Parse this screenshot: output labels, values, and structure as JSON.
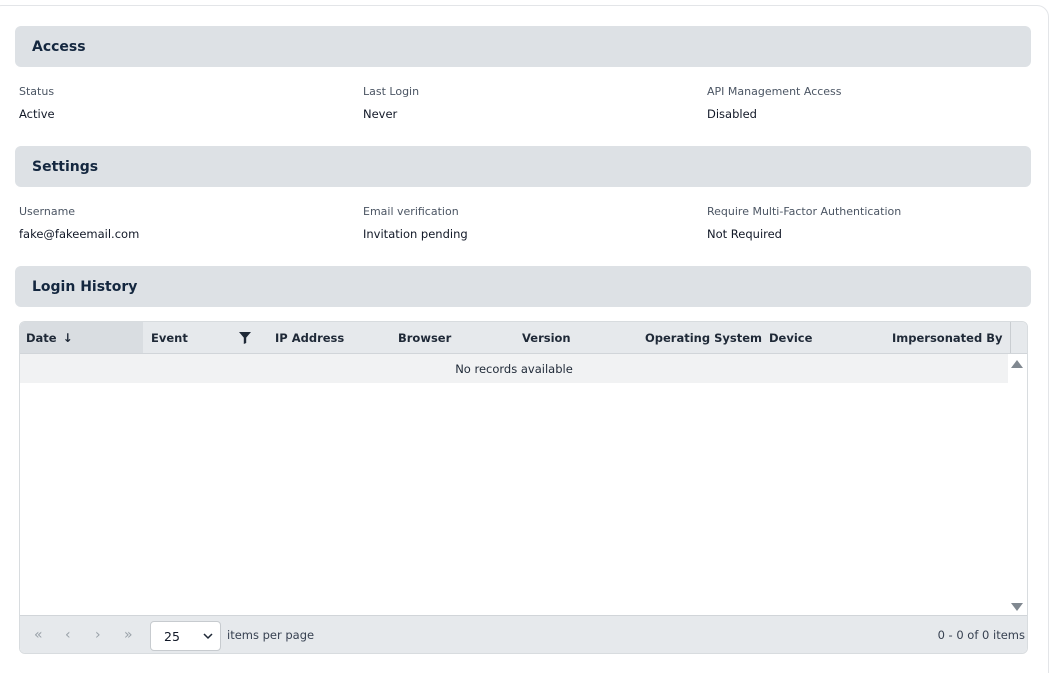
{
  "access": {
    "title": "Access",
    "fields": [
      {
        "label": "Status",
        "value": "Active"
      },
      {
        "label": "Last Login",
        "value": "Never"
      },
      {
        "label": "API Management Access",
        "value": "Disabled"
      }
    ]
  },
  "settings": {
    "title": "Settings",
    "fields": [
      {
        "label": "Username",
        "value": "fake@fakeemail.com"
      },
      {
        "label": "Email verification",
        "value": "Invitation pending"
      },
      {
        "label": "Require Multi-Factor Authentication",
        "value": "Not Required"
      }
    ]
  },
  "login_history": {
    "title": "Login History",
    "columns": [
      "Date",
      "Event",
      "IP Address",
      "Browser",
      "Version",
      "Operating System",
      "Device",
      "Impersonated By"
    ],
    "sort_indicator": "↓",
    "no_records": "No records available",
    "pager": {
      "first": "«",
      "prev": "‹",
      "next": "›",
      "last": "»",
      "page_size": "25",
      "items_per_page_label": "items per page",
      "info": "0 - 0 of 0 items"
    }
  },
  "icons": {
    "filter": "filter-icon",
    "sort": "arrow-down-icon",
    "scroll_up": "triangle-up-icon",
    "scroll_down": "triangle-down-icon",
    "dropdown": "chevron-down-icon"
  },
  "colors": {
    "section_header_bg": "#dde1e5",
    "section_header_text": "#14273f",
    "grid_header_bg": "#e6e9ec"
  }
}
